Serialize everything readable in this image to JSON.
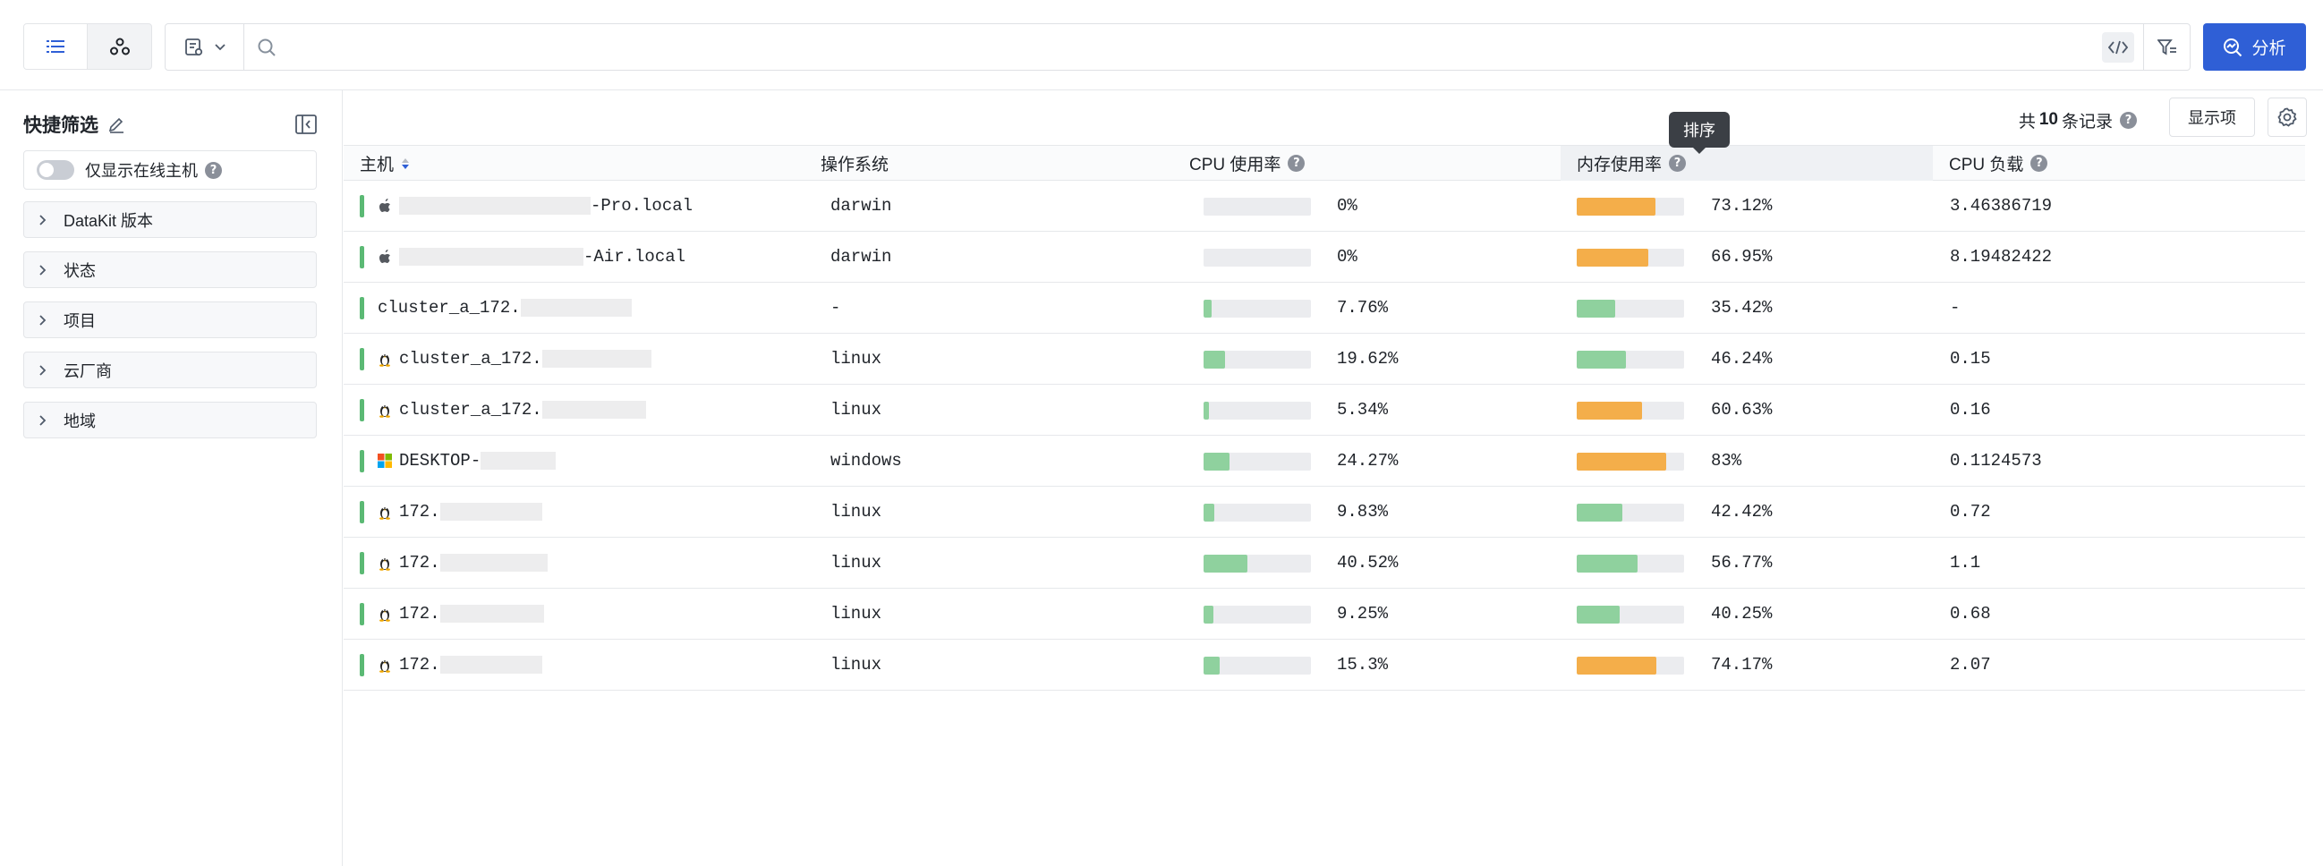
{
  "toolbar": {
    "analyze_label": "分析",
    "search_placeholder": ""
  },
  "sidebar": {
    "title": "快捷筛选",
    "online_only_label": "仅显示在线主机",
    "facets": [
      "DataKit 版本",
      "状态",
      "项目",
      "云厂商",
      "地域"
    ]
  },
  "main": {
    "records_prefix": "共",
    "records_count": "10",
    "records_suffix": "条记录",
    "display_button": "显示项",
    "tooltip": "排序"
  },
  "table": {
    "columns": {
      "host": "主机",
      "os": "操作系统",
      "cpu_usage": "CPU 使用率",
      "mem_usage": "内存使用率",
      "cpu_load": "CPU 负载"
    },
    "rows": [
      {
        "icon": "apple",
        "prefix": "",
        "suffix": "-Pro.local",
        "os": "darwin",
        "cpu": 0,
        "cpu_text": "0%",
        "mem": 73.12,
        "mem_text": "73.12%",
        "load": "3.46386719"
      },
      {
        "icon": "apple",
        "prefix": "",
        "suffix": "-Air.local",
        "os": "darwin",
        "cpu": 0,
        "cpu_text": "0%",
        "mem": 66.95,
        "mem_text": "66.95%",
        "load": "8.19482422"
      },
      {
        "icon": "",
        "prefix": "cluster_a_172.",
        "suffix": "",
        "os": "-",
        "cpu": 7.76,
        "cpu_text": "7.76%",
        "mem": 35.42,
        "mem_text": "35.42%",
        "load": "-"
      },
      {
        "icon": "linux",
        "prefix": "cluster_a_172.",
        "suffix": "",
        "os": "linux",
        "cpu": 19.62,
        "cpu_text": "19.62%",
        "mem": 46.24,
        "mem_text": "46.24%",
        "load": "0.15"
      },
      {
        "icon": "linux",
        "prefix": "cluster_a_172.",
        "suffix": "",
        "os": "linux",
        "cpu": 5.34,
        "cpu_text": "5.34%",
        "mem": 60.63,
        "mem_text": "60.63%",
        "load": "0.16"
      },
      {
        "icon": "windows",
        "prefix": "DESKTOP-",
        "suffix": "",
        "os": "windows",
        "cpu": 24.27,
        "cpu_text": "24.27%",
        "mem": 83,
        "mem_text": "83%",
        "load": "0.1124573"
      },
      {
        "icon": "linux",
        "prefix": "172.",
        "suffix": "",
        "os": "linux",
        "cpu": 9.83,
        "cpu_text": "9.83%",
        "mem": 42.42,
        "mem_text": "42.42%",
        "load": "0.72"
      },
      {
        "icon": "linux",
        "prefix": "172.",
        "suffix": "",
        "os": "linux",
        "cpu": 40.52,
        "cpu_text": "40.52%",
        "mem": 56.77,
        "mem_text": "56.77%",
        "load": "1.1"
      },
      {
        "icon": "linux",
        "prefix": "172.",
        "suffix": "",
        "os": "linux",
        "cpu": 9.25,
        "cpu_text": "9.25%",
        "mem": 40.25,
        "mem_text": "40.25%",
        "load": "0.68"
      },
      {
        "icon": "linux",
        "prefix": "172.",
        "suffix": "",
        "os": "linux",
        "cpu": 15.3,
        "cpu_text": "15.3%",
        "mem": 74.17,
        "mem_text": "74.17%",
        "load": "2.07"
      }
    ]
  },
  "colors": {
    "accent": "#2f5fd6",
    "bar_green": "#8fd19e",
    "bar_orange": "#f4ae4a",
    "status_green": "#5bb974",
    "mem_warn_threshold": 60
  }
}
